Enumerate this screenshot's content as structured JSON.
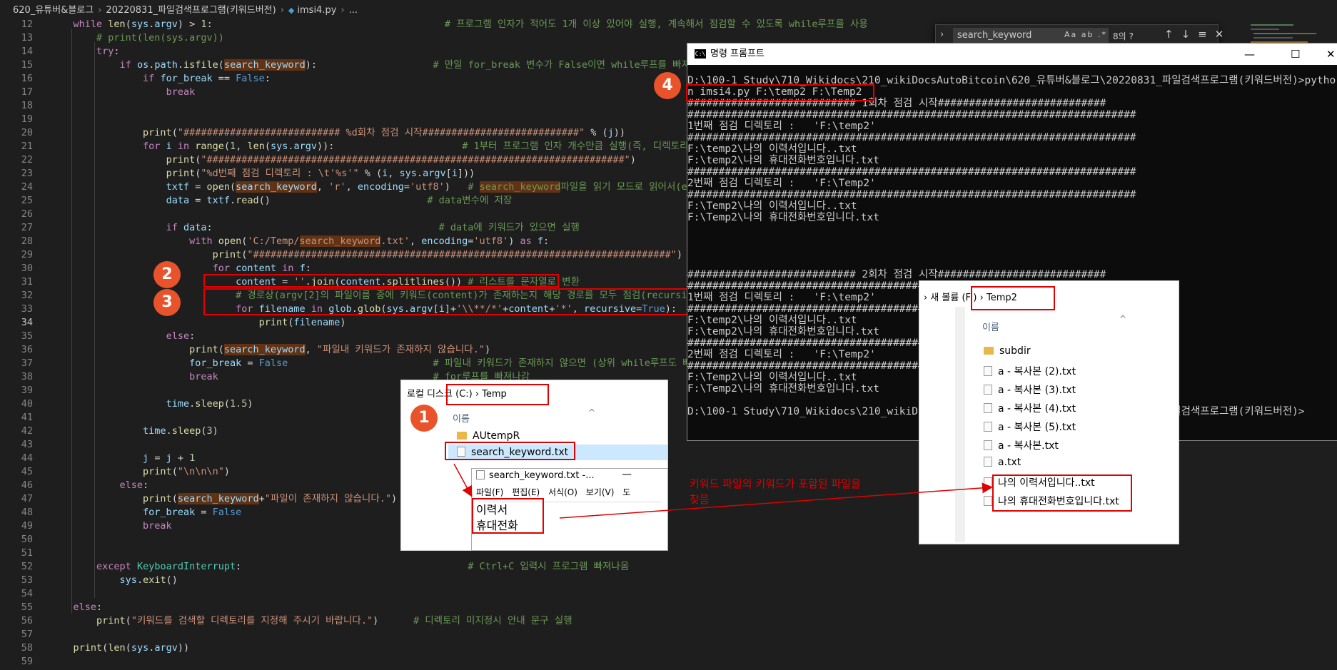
{
  "breadcrumb": {
    "parts": [
      "620_유튜버&블로그",
      "20220831_파일검색프로그램(키워드버전)",
      "imsi4.py",
      "..."
    ]
  },
  "find": {
    "value": "search_keyword",
    "options": "Aa ab .*",
    "count": "8의 ?"
  },
  "cmd": {
    "title": "명령 프롬프트",
    "lines": [
      "D:\\100-1 Study\\710_Wikidocs\\210_wikiDocsAutoBitcoin\\620_유튜버&블로그\\20220831_파일검색프로그램(키워드버전)>pytho",
      "n imsi4.py F:\\temp2 F:\\Temp2",
      "########################### 1회차 점검 시작###########################",
      "########################################################################",
      "1번째 점검 디렉토리 :   'F:\\temp2'",
      "########################################################################",
      "F:\\temp2\\나의 이력서입니다..txt",
      "F:\\temp2\\나의 휴대전화번호입니다.txt",
      "########################################################################",
      "2번째 점검 디렉토리 :   'F:\\Temp2'",
      "########################################################################",
      "F:\\Temp2\\나의 이력서입니다..txt",
      "F:\\Temp2\\나의 휴대전화번호입니다.txt",
      "",
      "",
      "",
      "",
      "########################### 2회차 점검 시작###########################",
      "########################################################################",
      "1번째 점검 디렉토리 :   'F:\\temp2'",
      "########################################################################",
      "F:\\temp2\\나의 이력서입니다..txt",
      "F:\\temp2\\나의 휴대전화번호입니다.txt",
      "########################################################################",
      "2번째 점검 디렉토리 :   'F:\\Temp2'",
      "########################################################################",
      "F:\\Temp2\\나의 이력서입니다..txt",
      "F:\\Temp2\\나의 휴대전화번호입니다.txt",
      "",
      "D:\\100-1 Study\\710_Wikidocs\\210_wikiDocsAutoBitcoin\\620_유튜버&블로그\\20220831_파일검색프로그램(키워드버전)>"
    ]
  },
  "exp1": {
    "address": [
      "로컬 디스크 (C:)",
      "Temp"
    ],
    "column": "이름",
    "items": [
      "AUtempR",
      "search_keyword.txt"
    ]
  },
  "notepad": {
    "title": "search_keyword.txt -...",
    "menu": [
      "파일(F)",
      "편집(E)",
      "서식(O)",
      "보기(V)",
      "도"
    ],
    "lines": [
      "이력서",
      "휴대전화"
    ]
  },
  "exp2": {
    "address": [
      "새 볼륨 (F:)",
      "Temp2"
    ],
    "column": "이름",
    "folder": "subdir",
    "items": [
      "a - 복사본 (2).txt",
      "a - 복사본 (3).txt",
      "a - 복사본 (4).txt",
      "a - 복사본 (5).txt",
      "a - 복사본.txt",
      "a.txt",
      "나의 이력서입니다..txt",
      "나의 휴대전화번호입니다.txt"
    ]
  },
  "annotations": {
    "badges": [
      "1",
      "2",
      "3",
      "4"
    ],
    "note": [
      "키워드 파일의  키워드가 포함된 파일을",
      "찾음"
    ]
  },
  "colors": {
    "accent_red": "#e00000",
    "badge": "#e8532b",
    "editor_bg": "#1e1e1e"
  }
}
